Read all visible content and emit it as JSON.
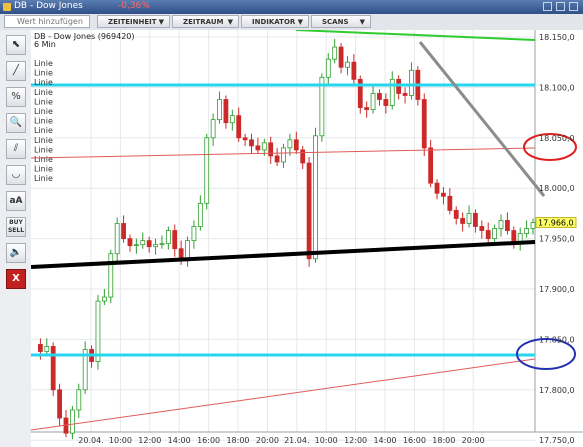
{
  "window": {
    "title": "DB - Dow Jones",
    "change": "-0,36%"
  },
  "toolbar": {
    "search_placeholder": "Wert hinzufügen",
    "menus": [
      "ZEITEINHEIT",
      "ZEITRAUM",
      "INDIKATOR",
      "SCANS"
    ]
  },
  "tools": [
    {
      "icon": "cursor-icon",
      "glyph": "⬉"
    },
    {
      "icon": "line-tool-icon",
      "glyph": "╱"
    },
    {
      "icon": "percent-icon",
      "glyph": "%"
    },
    {
      "icon": "zoom-icon",
      "glyph": "🔍"
    },
    {
      "icon": "parallel-lines-icon",
      "glyph": "⫽"
    },
    {
      "icon": "curve-icon",
      "glyph": "◡"
    },
    {
      "icon": "text-size-icon",
      "glyph": "aA"
    },
    {
      "icon": "buy-sell-icon",
      "glyph": "BUY SELL"
    },
    {
      "icon": "sound-icon",
      "glyph": "🔈"
    },
    {
      "icon": "close-icon",
      "glyph": "X"
    }
  ],
  "chart_header": {
    "instrument": "DB - Dow Jones (969420)",
    "interval": "6 Min",
    "drawing_labels": [
      "Linie",
      "Linie",
      "Linie",
      "Linie",
      "Linie",
      "Linie",
      "Linie",
      "Linie",
      "Linie",
      "Linie",
      "Linie",
      "Linie",
      "Linie"
    ]
  },
  "chart_data": {
    "type": "candlestick",
    "title": "DB - Dow Jones (969420)",
    "interval": "6 Min",
    "ylim": [
      17740,
      18160
    ],
    "yticks": [
      "18.150,0",
      "18.100,0",
      "18.050,0",
      "18.000,0",
      "17.950,0",
      "17.900,0",
      "17.850,0",
      "17.800,0",
      "17.750,0"
    ],
    "ytick_values": [
      18150,
      18100,
      18050,
      18000,
      17950,
      17900,
      17850,
      17800,
      17750
    ],
    "xticks": [
      "20.04.",
      "10:00",
      "12:00",
      "14:00",
      "16:00",
      "18:00",
      "20:00",
      "21.04.",
      "10:00",
      "12:00",
      "14:00",
      "16:00",
      "18:00",
      "20:00"
    ],
    "last_price": "17.966,0",
    "last_price_value": 17966,
    "price_path": [
      17845,
      17838,
      17843,
      17800,
      17772,
      17757,
      17780,
      17800,
      17840,
      17828,
      17888,
      17892,
      17935,
      17965,
      17950,
      17943,
      17944,
      17948,
      17942,
      17944,
      17945,
      17958,
      17940,
      17928,
      17948,
      17962,
      17985,
      18050,
      18068,
      18088,
      18065,
      18072,
      18050,
      18048,
      18042,
      18038,
      18045,
      18032,
      18026,
      18040,
      18048,
      18038,
      18025,
      17930,
      18052,
      18110,
      18128,
      18140,
      18120,
      18125,
      18108,
      18080,
      18078,
      18094,
      18088,
      18082,
      18108,
      18094,
      18092,
      18117,
      18088,
      18040,
      18005,
      17995,
      17992,
      17978,
      17970,
      17965,
      17975,
      17962,
      17958,
      17950,
      17960,
      17968,
      17958,
      17946,
      17955,
      17960,
      17966
    ]
  },
  "annotations": {
    "colors": {
      "green_line": "#2ecc2e",
      "cyan_line": "#25d6ec",
      "red_line": "#e05a5a",
      "black_line": "#000000",
      "gray_line": "#8c8c8c",
      "red_ellipse": "#e02020",
      "blue_ellipse": "#2431b0",
      "candle_up": "#2e9e2e",
      "candle_down": "#cc2a2a",
      "price_tag": "#ffff66"
    }
  }
}
